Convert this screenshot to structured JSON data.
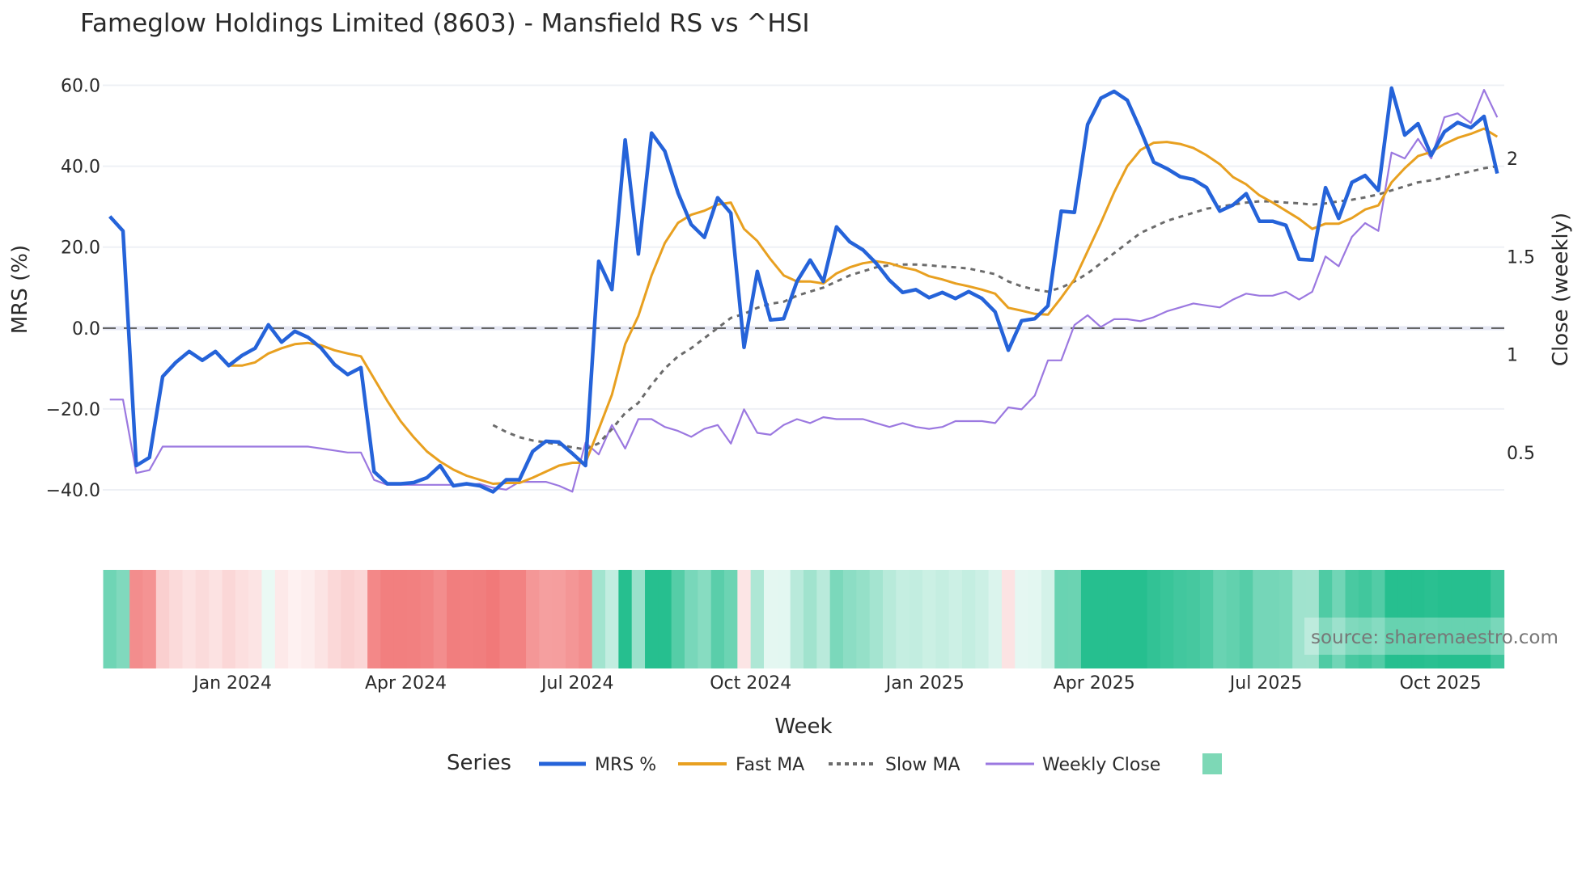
{
  "chart_data": {
    "type": "line",
    "title": "Fameglow Holdings Limited (8603) - Mansfield RS vs ^HSI",
    "xlabel": "Week",
    "ylabel": "MRS (%)",
    "y2label": "Close (weekly)",
    "ylim": [
      -47,
      63
    ],
    "y2lim": [
      0.28,
      2.43
    ],
    "yticks": [
      {
        "v": 60,
        "label": "60.0"
      },
      {
        "v": 40,
        "label": "40.0"
      },
      {
        "v": 20,
        "label": "20.0"
      },
      {
        "v": 0,
        "label": "0.0"
      },
      {
        "v": -20,
        "label": "−20.0"
      },
      {
        "v": -40,
        "label": "−40.0"
      }
    ],
    "y2ticks": [
      {
        "v": 2,
        "label": "2"
      },
      {
        "v": 1.5,
        "label": "1.5"
      },
      {
        "v": 1,
        "label": "1"
      },
      {
        "v": 0.5,
        "label": "0.5"
      }
    ],
    "xticks": [
      {
        "week": 9.3,
        "label": "Jan 2024"
      },
      {
        "week": 22.4,
        "label": "Apr 2024"
      },
      {
        "week": 35.4,
        "label": "Jul 2024"
      },
      {
        "week": 48.5,
        "label": "Oct 2024"
      },
      {
        "week": 61.7,
        "label": "Jan 2025"
      },
      {
        "week": 74.5,
        "label": "Apr 2025"
      },
      {
        "week": 87.5,
        "label": "Jul 2025"
      },
      {
        "week": 100.7,
        "label": "Oct 2025"
      }
    ],
    "legend_title": "Series",
    "legend_position": "bottom",
    "source": "source: sharemaestro.com",
    "colors": {
      "mrs": "#2563d9",
      "fast": "#e8a020",
      "slow": "#6b6b6b",
      "close": "#9b78e0",
      "pos": "#26bf8f",
      "neg": "#f07070"
    },
    "series": [
      {
        "key": "mrs",
        "name": "MRS %",
        "start": 0,
        "values": [
          27.6,
          24,
          -34,
          -32,
          -12,
          -8.5,
          -5.8,
          -8,
          -5.8,
          -9.3,
          -6.8,
          -5,
          0.8,
          -3.5,
          -0.8,
          -2.3,
          -5,
          -9,
          -11.5,
          -9.8,
          -35.5,
          -38.5,
          -38.5,
          -38.2,
          -37,
          -34,
          -39,
          -38.5,
          -39,
          -40.5,
          -37.5,
          -37.5,
          -30.5,
          -28,
          -28.2,
          -31,
          -34,
          16.5,
          9.5,
          46.5,
          18.3,
          48.2,
          43.7,
          33.4,
          25.6,
          22.4,
          32.2,
          28.4,
          -4.8,
          14,
          2,
          2.3,
          11.5,
          16.8,
          11.5,
          25,
          21.3,
          19.3,
          16,
          11.8,
          8.8,
          9.5,
          7.5,
          8.8,
          7.3,
          9,
          7.3,
          4,
          -5.5,
          1.8,
          2.3,
          5.5,
          28.9,
          28.6,
          50.3,
          56.8,
          58.5,
          56.3,
          49,
          41,
          39.4,
          37.4,
          36.7,
          34.7,
          28.9,
          30.4,
          33.2,
          26.4,
          26.4,
          25.4,
          17,
          16.8,
          34.7,
          27.1,
          36,
          37.7,
          34,
          59.3,
          47.7,
          50.5,
          42.7,
          48.5,
          50.8,
          49.5,
          52.3,
          38.2
        ]
      },
      {
        "key": "fast",
        "name": "Fast MA",
        "start": 9,
        "values": [
          -9.3,
          -9.3,
          -8.5,
          -6.3,
          -5,
          -4,
          -3.7,
          -4.3,
          -5.5,
          -6.3,
          -7,
          -12.5,
          -18,
          -23,
          -27,
          -30.5,
          -33,
          -35,
          -36.5,
          -37.5,
          -38.5,
          -38.3,
          -38.3,
          -37,
          -35.5,
          -34,
          -33.3,
          -33.3,
          -25,
          -16.5,
          -4,
          3,
          13,
          21,
          26,
          28,
          29,
          30.5,
          31,
          24.5,
          21.5,
          17,
          13,
          11.5,
          11.5,
          11,
          13.5,
          15,
          16,
          16.5,
          16,
          15,
          14.3,
          12.8,
          12,
          11,
          10.3,
          9.5,
          8.5,
          5,
          4.3,
          3.5,
          3.3,
          7.5,
          12,
          19,
          26,
          33.5,
          40,
          44,
          45.8,
          46,
          45.5,
          44.5,
          42.7,
          40.5,
          37.3,
          35.5,
          32.8,
          31,
          29,
          27,
          24.5,
          25.8,
          25.8,
          27.2,
          29.3,
          30.3,
          36,
          39.5,
          42.5,
          43.5,
          45.5,
          47,
          48,
          49.3,
          47.3
        ]
      },
      {
        "key": "slow",
        "name": "Slow MA",
        "start": 29,
        "values": [
          -24,
          -25.7,
          -27,
          -27.8,
          -28.3,
          -28.8,
          -29.5,
          -30,
          -28.5,
          -25,
          -21,
          -18.5,
          -14,
          -10,
          -7,
          -5,
          -2.5,
          0,
          2.5,
          3.5,
          5,
          6,
          6.5,
          8,
          9,
          10,
          11.5,
          13,
          14,
          15,
          15.5,
          15.7,
          15.7,
          15.5,
          15.2,
          15,
          14.7,
          14,
          13.3,
          11.5,
          10.3,
          9.5,
          9,
          10,
          11.5,
          13.5,
          16,
          18.5,
          21,
          23.5,
          25,
          26.5,
          27.5,
          28.5,
          29.5,
          30,
          30.5,
          31,
          31.3,
          31.3,
          31,
          30.8,
          30.5,
          30.8,
          31.3,
          31.7,
          32.3,
          33,
          34,
          35,
          36,
          36.5,
          37.2,
          38,
          38.7,
          39.5,
          40
        ]
      },
      {
        "key": "close",
        "name": "Weekly Close",
        "axis": "right",
        "start": 0,
        "values": [
          0.77,
          0.77,
          0.395,
          0.41,
          0.53,
          0.53,
          0.53,
          0.53,
          0.53,
          0.53,
          0.53,
          0.53,
          0.53,
          0.53,
          0.53,
          0.53,
          0.52,
          0.51,
          0.5,
          0.5,
          0.36,
          0.335,
          0.335,
          0.335,
          0.335,
          0.335,
          0.335,
          0.335,
          0.34,
          0.32,
          0.31,
          0.35,
          0.35,
          0.35,
          0.33,
          0.3,
          0.55,
          0.49,
          0.64,
          0.52,
          0.67,
          0.67,
          0.63,
          0.61,
          0.58,
          0.62,
          0.64,
          0.545,
          0.72,
          0.6,
          0.59,
          0.64,
          0.67,
          0.65,
          0.68,
          0.67,
          0.67,
          0.67,
          0.65,
          0.63,
          0.65,
          0.63,
          0.62,
          0.63,
          0.66,
          0.66,
          0.66,
          0.65,
          0.73,
          0.72,
          0.79,
          0.97,
          0.97,
          1.15,
          1.2,
          1.14,
          1.18,
          1.18,
          1.17,
          1.19,
          1.22,
          1.24,
          1.26,
          1.25,
          1.24,
          1.28,
          1.31,
          1.3,
          1.3,
          1.32,
          1.28,
          1.32,
          1.5,
          1.45,
          1.6,
          1.67,
          1.63,
          2.03,
          2.0,
          2.1,
          2.0,
          2.21,
          2.23,
          2.18,
          2.35,
          2.21
        ]
      }
    ]
  }
}
